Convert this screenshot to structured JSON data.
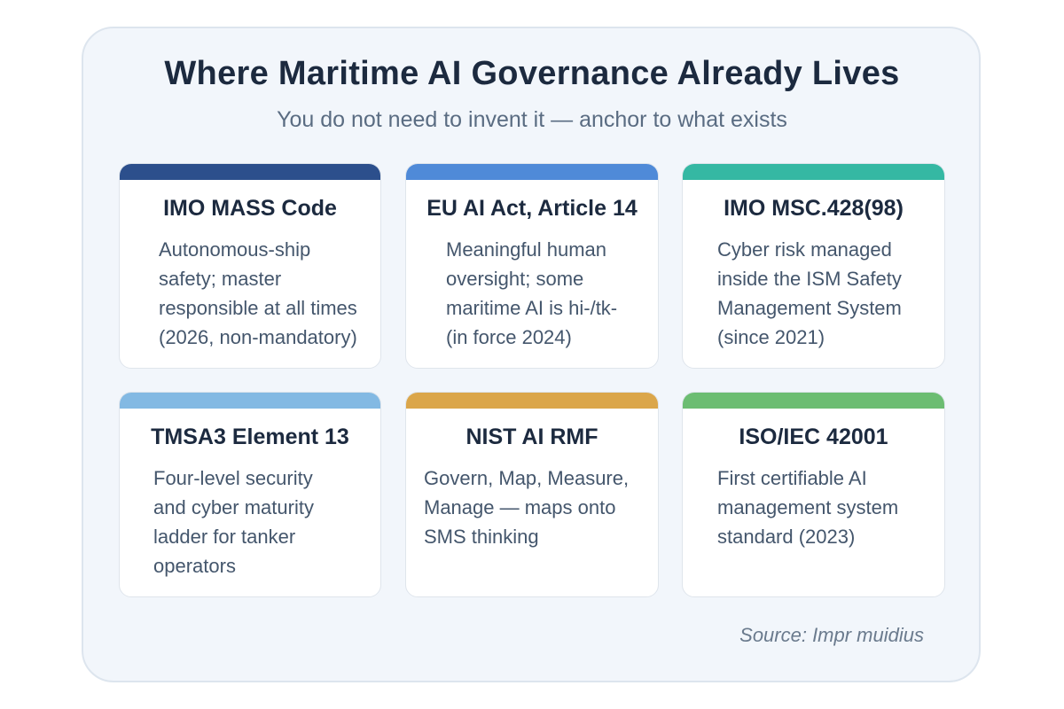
{
  "header": {
    "title": "Where Maritime AI Governance Already Lives",
    "subtitle": "You do not need to invent it — anchor to what exists"
  },
  "cards": [
    {
      "title": "IMO MASS Code",
      "body": "Autonomous-ship\nsafety; master\nresponsible at all times\n(2026, non-mandatory)",
      "accent": "#2c4f8c"
    },
    {
      "title": "EU AI Act, Article 14",
      "body": "Meaningful human\noversight; some\nmaritime AI is hi-/tk-\n(in force 2024)",
      "accent": "#4f8ad8"
    },
    {
      "title": "IMO MSC.428(98)",
      "body": "Cyber risk managed\ninside the ISM Safety\nManagement System\n(since 2021)",
      "accent": "#35b8a3"
    },
    {
      "title": "TMSA3 Element 13",
      "body": "Four-level security\nand cyber maturity\nladder for tanker\noperators",
      "accent": "#83b9e3"
    },
    {
      "title": "NIST AI RMF",
      "body": "Govern, Map, Measure,\nManage — maps onto\nSMS thinking",
      "accent": "#dba64a"
    },
    {
      "title": "ISO/IEC 42001",
      "body": "First certifiable AI\nmanagement system\nstandard (2023)",
      "accent": "#6cbd72"
    }
  ],
  "footer": {
    "source": "Source: Impr muidius"
  }
}
